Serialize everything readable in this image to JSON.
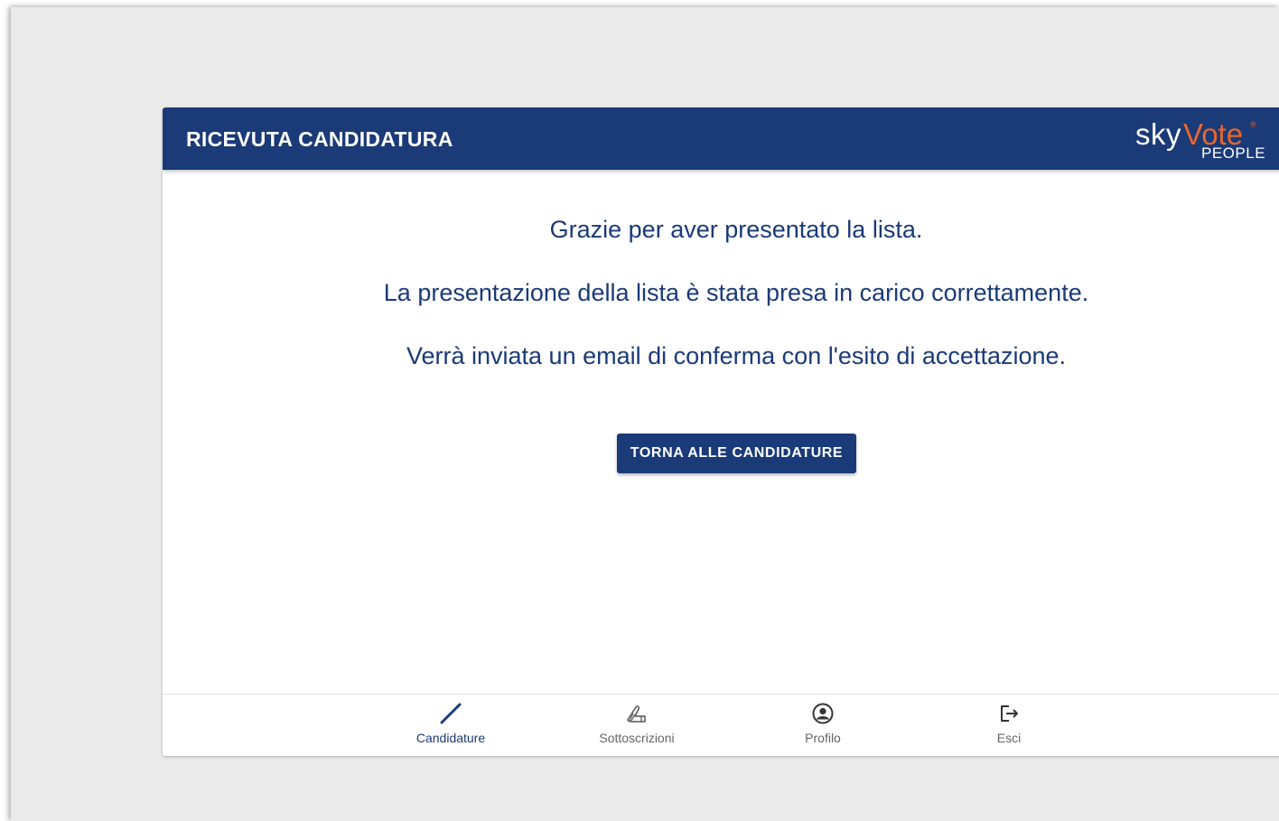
{
  "header": {
    "title": "RICEVUTA CANDIDATURA",
    "logo": {
      "sky": "sky",
      "vote": "Vote",
      "registered": "®",
      "people": "PEOPLE"
    }
  },
  "main": {
    "messages": [
      "Grazie per aver presentato la lista.",
      "La presentazione della lista è stata presa in carico correttamente.",
      "Verrà inviata un email di conferma con l'esito di accettazione."
    ],
    "button_label": "TORNA ALLE CANDIDATURE"
  },
  "bottom_nav": {
    "items": [
      {
        "label": "Candidature",
        "icon": "pencil-icon",
        "active": true
      },
      {
        "label": "Sottoscrizioni",
        "icon": "signature-icon",
        "active": false
      },
      {
        "label": "Profilo",
        "icon": "user-circle-icon",
        "active": false
      },
      {
        "label": "Esci",
        "icon": "logout-icon",
        "active": false
      }
    ]
  },
  "colors": {
    "primary": "#1a3a78",
    "accent": "#e8662c",
    "background": "#ebebeb",
    "inactive": "#666666"
  }
}
